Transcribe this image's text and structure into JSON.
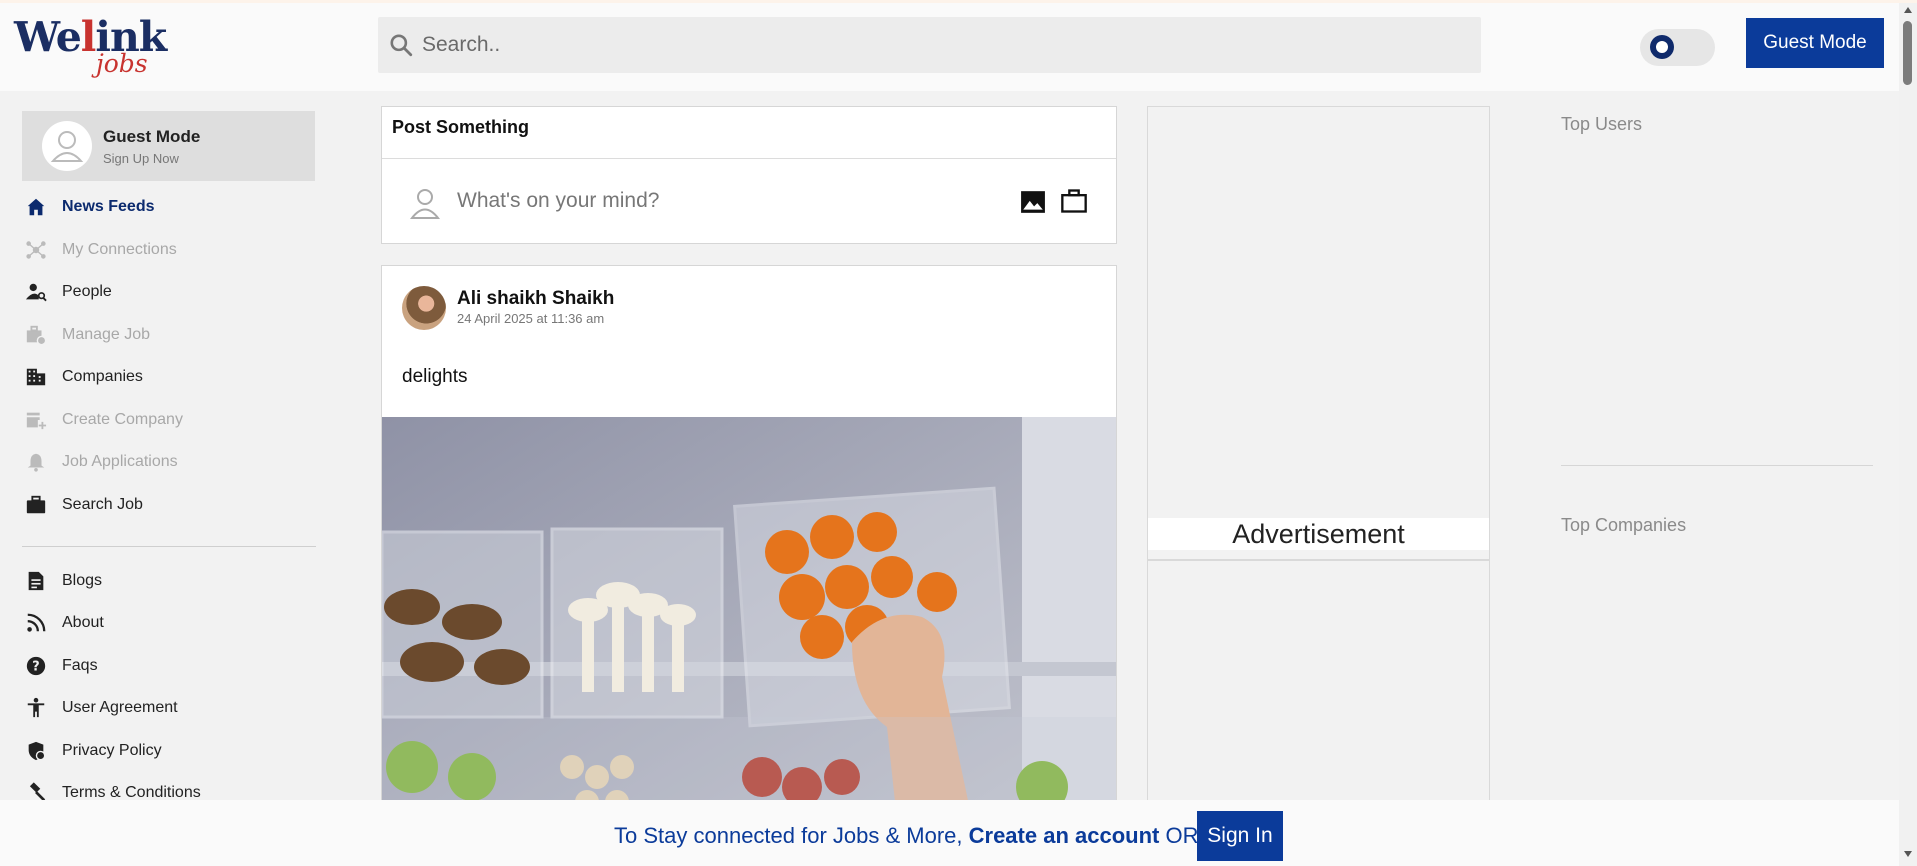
{
  "header": {
    "logo_main": "Welink",
    "logo_sub": "jobs",
    "search_placeholder": "Search..",
    "guest_button": "Guest Mode"
  },
  "sidebar": {
    "profile": {
      "name": "Guest Mode",
      "subtitle": "Sign Up Now"
    },
    "items": [
      {
        "label": "News Feeds",
        "icon": "home-icon",
        "state": "active"
      },
      {
        "label": "My Connections",
        "icon": "connections-icon",
        "state": "disabled"
      },
      {
        "label": "People",
        "icon": "people-search-icon",
        "state": "normal"
      },
      {
        "label": "Manage Job",
        "icon": "manage-job-icon",
        "state": "disabled"
      },
      {
        "label": "Companies",
        "icon": "building-icon",
        "state": "normal"
      },
      {
        "label": "Create Company",
        "icon": "add-business-icon",
        "state": "disabled"
      },
      {
        "label": "Job Applications",
        "icon": "bell-icon",
        "state": "disabled"
      },
      {
        "label": "Search Job",
        "icon": "briefcase-icon",
        "state": "normal"
      }
    ],
    "links": [
      {
        "label": "Blogs",
        "icon": "document-icon"
      },
      {
        "label": "About",
        "icon": "rss-icon"
      },
      {
        "label": "Faqs",
        "icon": "help-icon"
      },
      {
        "label": "User Agreement",
        "icon": "accessibility-icon"
      },
      {
        "label": "Privacy Policy",
        "icon": "shield-lock-icon"
      },
      {
        "label": "Terms & Conditions",
        "icon": "gavel-icon"
      }
    ]
  },
  "composer": {
    "title": "Post Something",
    "placeholder": "What's on your mind?"
  },
  "post": {
    "author": "Ali shaikh Shaikh",
    "date": "24 April 2025 at 11:36 am",
    "text": "delights"
  },
  "ads": {
    "label": "Advertisement"
  },
  "right_column": {
    "top_users": "Top Users",
    "top_companies": "Top Companies"
  },
  "banner": {
    "prefix": "To Stay connected for Jobs & More, ",
    "create_account": "Create an account",
    "or": " OR ",
    "sign_in": "Sign In"
  },
  "colors": {
    "brand_blue": "#0b3b9a",
    "brand_navy": "#1b2e63",
    "brand_red": "#c8332f"
  }
}
